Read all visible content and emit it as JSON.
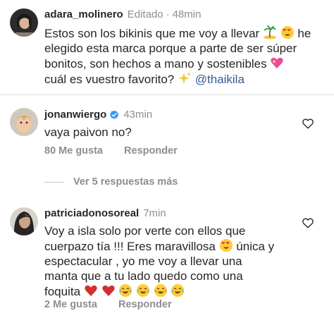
{
  "comments": [
    {
      "username": "adara_molinero",
      "edited": "Editado",
      "dot": "·",
      "time": "48min",
      "line1_a": "Estos son los bikinis que me voy a llevar",
      "line1_b": "he",
      "line2": "elegido esta marca porque a parte de ser súper",
      "line3": "bonitos, son hechos a mano y sostenibles",
      "line4_a": "cuál es vuestro favorito?",
      "mention": "@thaikila"
    },
    {
      "username": "jonanwiergo",
      "time": "43min",
      "text": "vaya paivon no?",
      "likes": "80 Me gusta",
      "reply": "Responder"
    },
    {
      "more_replies": "Ver 5 respuestas más"
    },
    {
      "username": "patriciadonosoreal",
      "time": "7min",
      "line1": "Voy a isla solo por verte con ellos que",
      "line2_a": "cuerpazo tía !!! Eres maravillosa",
      "line2_b": "única y",
      "line3": "espectacular , yo me voy a llevar una",
      "line4": "manta que a tu lado quedo como una",
      "line5": "foquita",
      "likes": "2 Me gusta",
      "reply": "Responder"
    }
  ],
  "icons": [
    "verified-badge-icon",
    "heart-outline-icon",
    "island-emoji",
    "heart-eyes-emoji",
    "sparkling-heart-emoji",
    "sparkles-emoji",
    "red-heart-emoji",
    "tears-of-joy-emoji"
  ],
  "colors": {
    "mention": "#385898",
    "verified": "#3897f0",
    "secondary_text": "#8e8e8e",
    "red_heart": "#d32f2f"
  }
}
